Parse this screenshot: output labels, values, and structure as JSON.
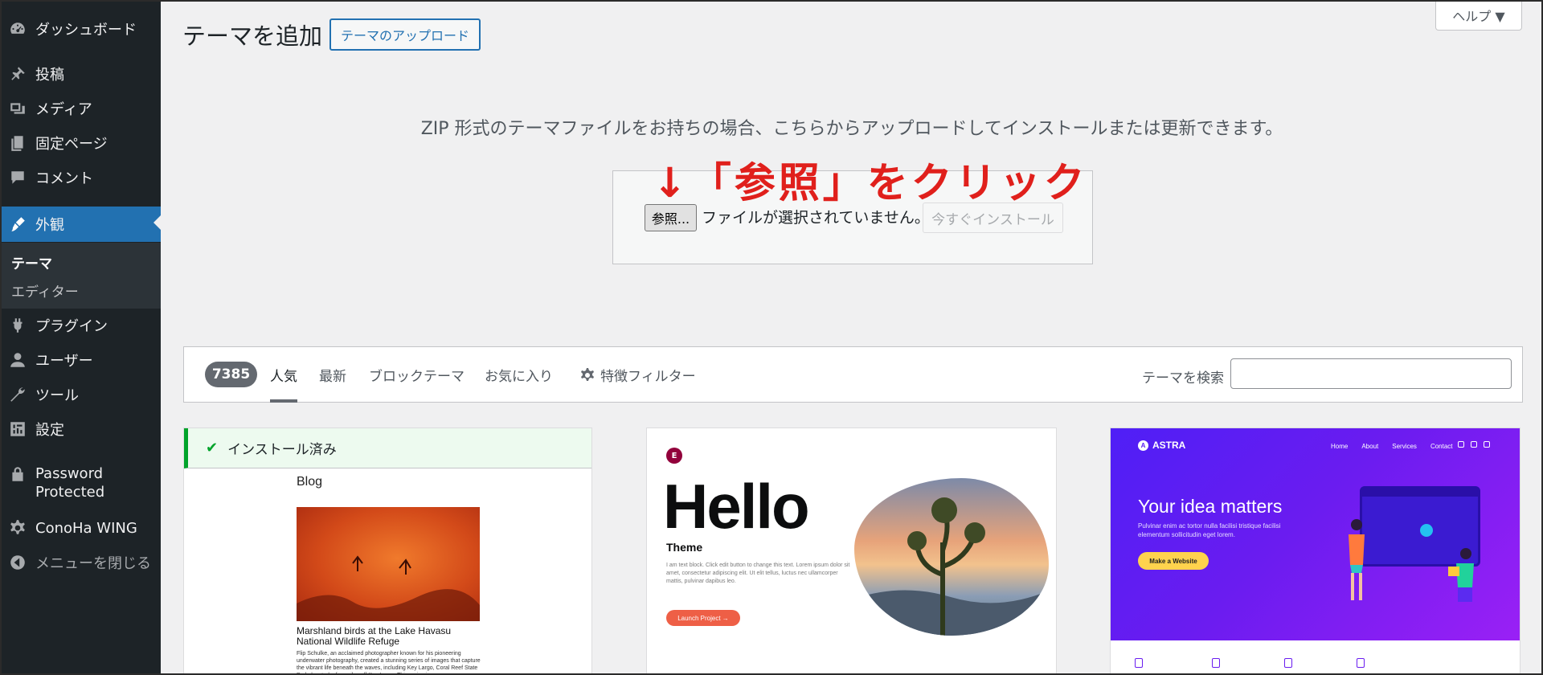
{
  "sidebar": {
    "items": [
      {
        "label": "ダッシュボード",
        "icon": "dashboard-icon"
      },
      {
        "label": "投稿",
        "icon": "pin-icon"
      },
      {
        "label": "メディア",
        "icon": "media-icon"
      },
      {
        "label": "固定ページ",
        "icon": "page-icon"
      },
      {
        "label": "コメント",
        "icon": "comment-icon"
      },
      {
        "label": "外観",
        "icon": "appearance-icon"
      },
      {
        "label": "プラグイン",
        "icon": "plugin-icon"
      },
      {
        "label": "ユーザー",
        "icon": "user-icon"
      },
      {
        "label": "ツール",
        "icon": "wrench-icon"
      },
      {
        "label": "設定",
        "icon": "settings-icon"
      },
      {
        "label": "Password Protected",
        "icon": "lock-icon"
      },
      {
        "label": "ConoHa WING",
        "icon": "gear-icon"
      },
      {
        "label": "メニューを閉じる",
        "icon": "collapse-icon"
      }
    ],
    "submenu": [
      "テーマ",
      "エディター"
    ]
  },
  "header": {
    "help": "ヘルプ ▼",
    "title": "テーマを追加",
    "upload_button": "テーマのアップロード"
  },
  "upload": {
    "description": "ZIP 形式のテーマファイルをお持ちの場合、こちらからアップロードしてインストールまたは更新できます。",
    "annotation": "↓「参照」をクリック",
    "browse_button": "参照...",
    "file_status": "ファイルが選択されていません。",
    "install_button": "今すぐインストール"
  },
  "filter": {
    "count": "7385",
    "tabs": [
      "人気",
      "最新",
      "ブロックテーマ",
      "お気に入り"
    ],
    "feature_filter": "特徴フィルター",
    "search_label": "テーマを検索",
    "search_value": ""
  },
  "cards": {
    "installed": {
      "badge": "インストール済み",
      "blog_title": "Blog",
      "caption": "Marshland birds at the Lake Havasu National Wildlife Refuge",
      "body": "Flip Schulke, an acclaimed photographer known for his pioneering underwater photography, created a stunning series of images that capture the vibrant life beneath the waves, including Key Largo, Coral Reef State Park, located a few miles off Key Largo. This series is"
    },
    "hello": {
      "logo": "E",
      "word": "Hello",
      "subtitle": "Theme",
      "text": "I am text block. Click edit button to change this text. Lorem ipsum dolor sit amet, consectetur adipiscing elit. Ut elit tellus, luctus nec ullamcorper mattis, pulvinar dapibus leo.",
      "button": "Launch Project →"
    },
    "astra": {
      "logo": "ASTRA",
      "nav": [
        "Home",
        "About",
        "Services",
        "Contact"
      ],
      "headline": "Your idea matters",
      "text": "Pulvinar enim ac tortor nulla facilisi tristique facilisi elementum sollicitudin eget lorem.",
      "button": "Make a Website"
    }
  }
}
